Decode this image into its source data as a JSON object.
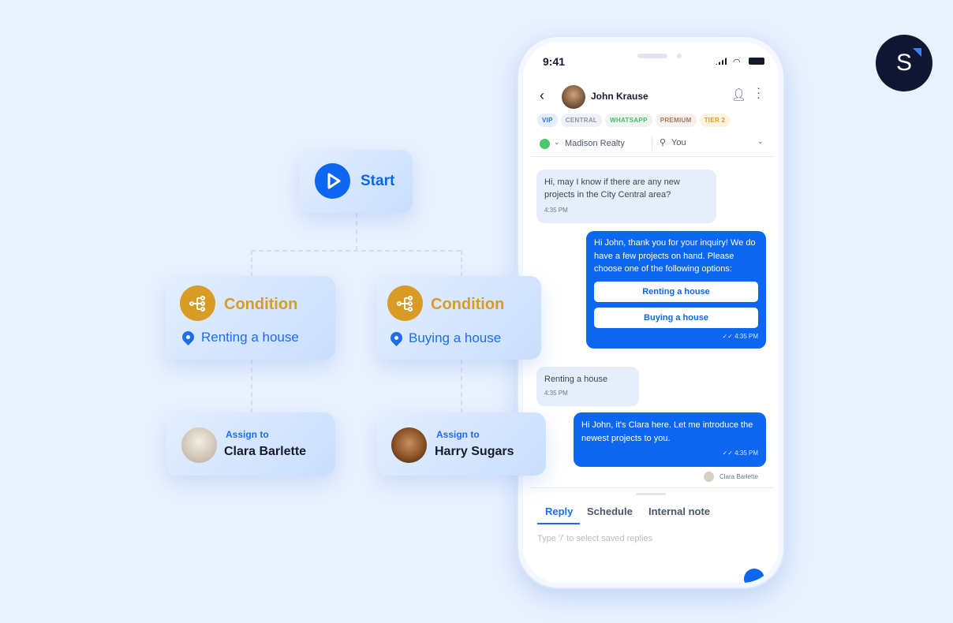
{
  "flow": {
    "start": {
      "label": "Start"
    },
    "conditions": [
      {
        "title": "Condition",
        "value": "Renting a house"
      },
      {
        "title": "Condition",
        "value": "Buying a house"
      }
    ],
    "assignments": [
      {
        "label": "Assign to",
        "name": "Clara Barlette"
      },
      {
        "label": "Assign to",
        "name": "Harry Sugars"
      }
    ]
  },
  "brand": {
    "logo_letter": "S",
    "bg": "#0f1631",
    "accent": "#3b82f6"
  },
  "phone": {
    "status_time": "9:41",
    "contact": {
      "name": "John Krause"
    },
    "tags": [
      {
        "label": "VIP",
        "bg": "#e3eeff",
        "color": "#2f6fe4"
      },
      {
        "label": "CENTRAL",
        "bg": "#eef1f5",
        "color": "#8a94a3"
      },
      {
        "label": "WHATSAPP",
        "bg": "#eef4ef",
        "color": "#3fbf6a"
      },
      {
        "label": "PREMIUM",
        "bg": "#f4f1ee",
        "color": "#a07a5a"
      },
      {
        "label": "TIER 2",
        "bg": "#fdf3e0",
        "color": "#d89b25"
      }
    ],
    "channel": "Madison Realty",
    "assignee": "You",
    "messages": [
      {
        "dir": "in",
        "text": "Hi, may I know if there are any new projects in the City Central area?",
        "time": "4:35 PM"
      },
      {
        "dir": "out",
        "text": "Hi John, thank you for your inquiry! We do have a few projects on hand. Please choose one of the following options:",
        "options": [
          "Renting a house",
          "Buying a house"
        ],
        "time": "4:35 PM"
      },
      {
        "dir": "in",
        "text": "Renting a house",
        "time": "4:35 PM"
      },
      {
        "dir": "out",
        "text": "Hi John, it's Clara here. Let me introduce the newest projects to you.",
        "time": "4:35 PM",
        "sender": "Clara Barlette"
      }
    ],
    "composer": {
      "tabs": [
        "Reply",
        "Schedule",
        "Internal note"
      ],
      "active_tab": "Reply",
      "placeholder": "Type '/' to select saved replies"
    }
  }
}
